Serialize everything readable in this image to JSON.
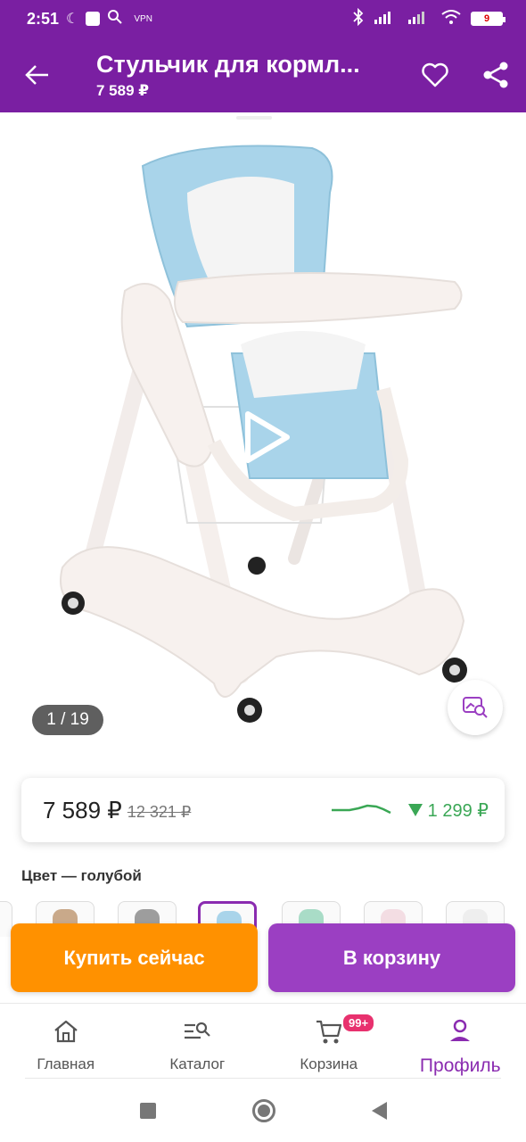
{
  "status_bar": {
    "time": "2:51",
    "vpn": "VPN",
    "battery": "9"
  },
  "header": {
    "title": "Стульчик для кормл...",
    "subtitle": "7 589 ₽"
  },
  "gallery": {
    "counter": "1 / 19"
  },
  "price": {
    "current": "7 589 ₽",
    "old": "12 321 ₽",
    "drop": "1 299 ₽",
    "drop_color": "#3aa755"
  },
  "color": {
    "label": "Цвет — голубой"
  },
  "actions": {
    "buy_now": "Купить сейчас",
    "add_to_cart": "В корзину"
  },
  "bottom_nav": {
    "items": [
      {
        "label": "Главная",
        "icon": "home-icon"
      },
      {
        "label": "Каталог",
        "icon": "catalog-search-icon"
      },
      {
        "label": "Корзина",
        "icon": "cart-icon",
        "badge": "99+"
      },
      {
        "label": "Профиль",
        "icon": "profile-icon",
        "active": true
      }
    ]
  },
  "colors": {
    "brand": "#7a1fa2",
    "buy_now": "#ff9100",
    "cart": "#9b3fc2",
    "active_nav": "#8a2bb0",
    "badge": "#e8316e"
  }
}
